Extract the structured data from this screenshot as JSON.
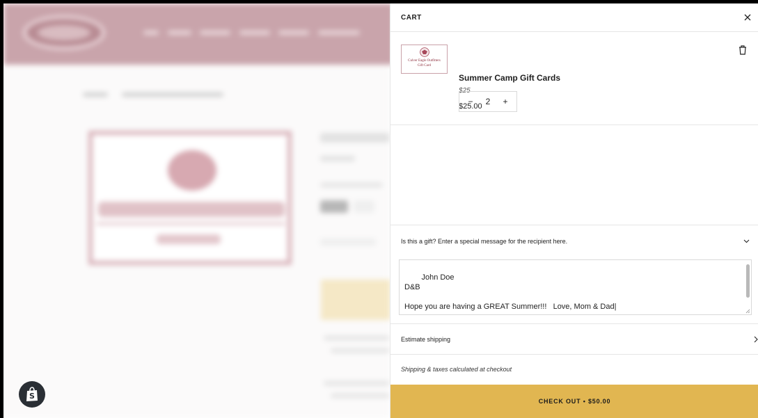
{
  "colors": {
    "accent": "#e1b651",
    "brand": "#c9a4ab"
  },
  "cart": {
    "title": "CART",
    "close_icon": "close-icon",
    "item": {
      "title": "Summer Camp Gift Cards",
      "variant": "$25",
      "price": "$25.00",
      "quantity": "2",
      "decrement_label": "−",
      "increment_label": "+",
      "thumbnail": {
        "line1": "Culver Eagle Outfitters",
        "line2": "Gift Card"
      },
      "delete_icon": "trash-icon"
    },
    "gift": {
      "label": "Is this a gift? Enter a special message for the recipient here.",
      "message": "John Doe\nD&B\n\nHope you are having a GREAT Summer!!!   Love, Mom & Dad|"
    },
    "shipping": {
      "label": "Estimate shipping"
    },
    "tax_note": "Shipping & taxes calculated at checkout",
    "checkout_label": "CHECK OUT • $50.00"
  }
}
